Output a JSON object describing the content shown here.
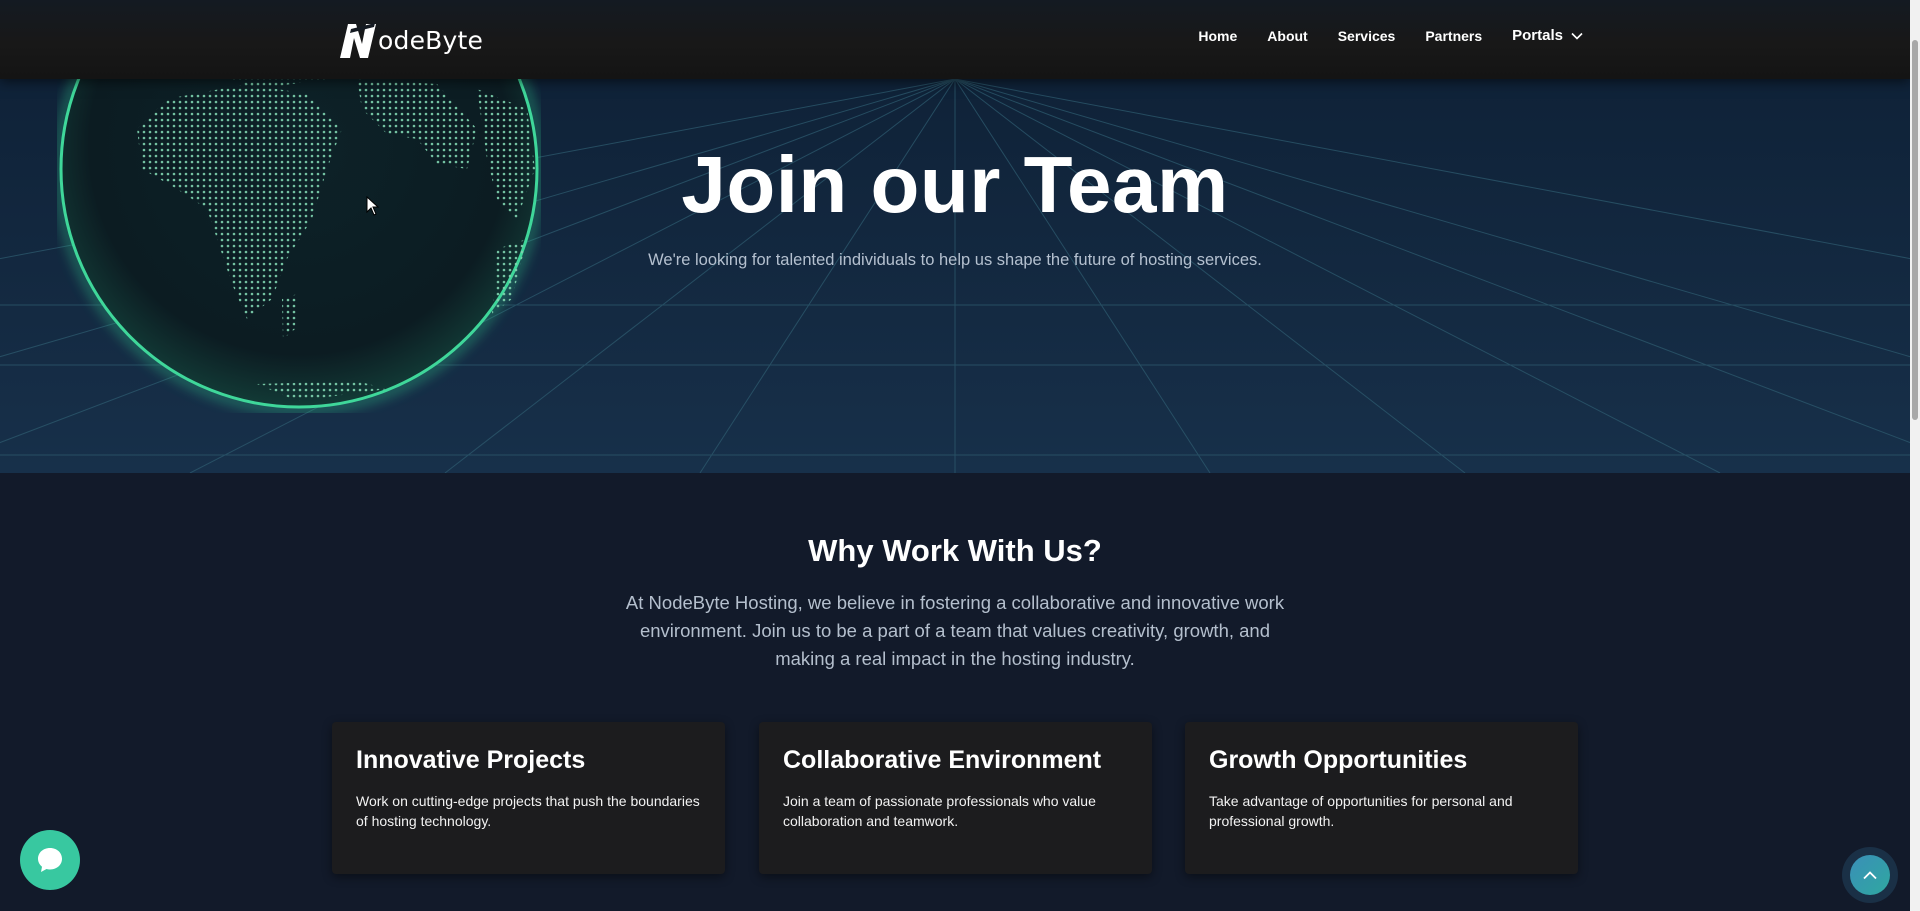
{
  "header": {
    "logo_text": "odeByte",
    "logo_letter": "N",
    "nav": [
      "Home",
      "About",
      "Services",
      "Partners"
    ],
    "portals_label": "Portals"
  },
  "hero": {
    "title": "Join our Team",
    "subtitle": "We're looking for talented individuals to help us shape the future of hosting services."
  },
  "why": {
    "title": "Why Work With Us?",
    "text": "At NodeByte Hosting, we believe in fostering a collaborative and innovative work environment. Join us to be a part of a team that values creativity, growth, and making a real impact in the hosting industry.",
    "cards": [
      {
        "title": "Innovative Projects",
        "text": "Work on cutting-edge projects that push the boundaries of hosting technology."
      },
      {
        "title": "Collaborative Environment",
        "text": "Join a team of passionate professionals who value collaboration and teamwork."
      },
      {
        "title": "Growth Opportunities",
        "text": "Take advantage of opportunities for personal and professional growth."
      }
    ]
  },
  "icons": {
    "chat": "chat-bubble-icon",
    "scroll_top": "chevron-up-icon",
    "portals": "chevron-down-icon",
    "globe": "globe-icon",
    "cursor": "mouse-pointer-icon"
  },
  "colors": {
    "accent": "#38c8a0",
    "hero_bg": "#142a42",
    "section_bg": "#121a2a",
    "card_bg": "#1c1c1e",
    "muted_text": "#b4c0cf"
  }
}
